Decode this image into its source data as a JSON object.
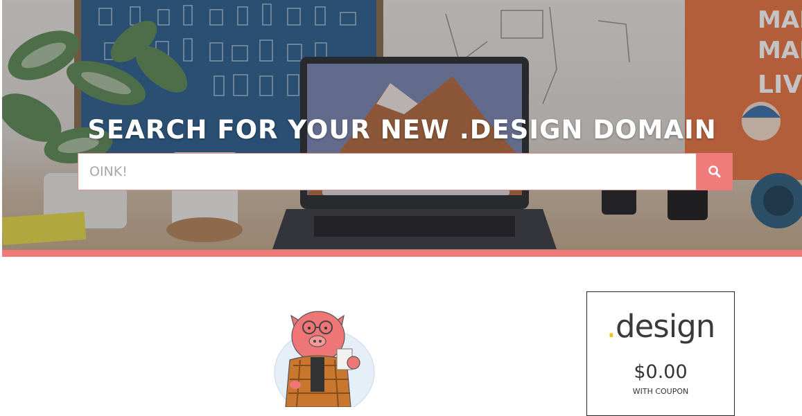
{
  "hero": {
    "title": "SEARCH FOR YOUR NEW .DESIGN DOMAIN",
    "search_placeholder": "OINK!",
    "search_icon": "search-icon"
  },
  "colors": {
    "accent": "#f07878",
    "dot": "#f3c21a"
  },
  "pricing": {
    "tld_dot": ".",
    "tld_name": "design",
    "price": "$0.00",
    "note": "WITH COUPON"
  },
  "illustration": {
    "name": "pig-mascot"
  }
}
